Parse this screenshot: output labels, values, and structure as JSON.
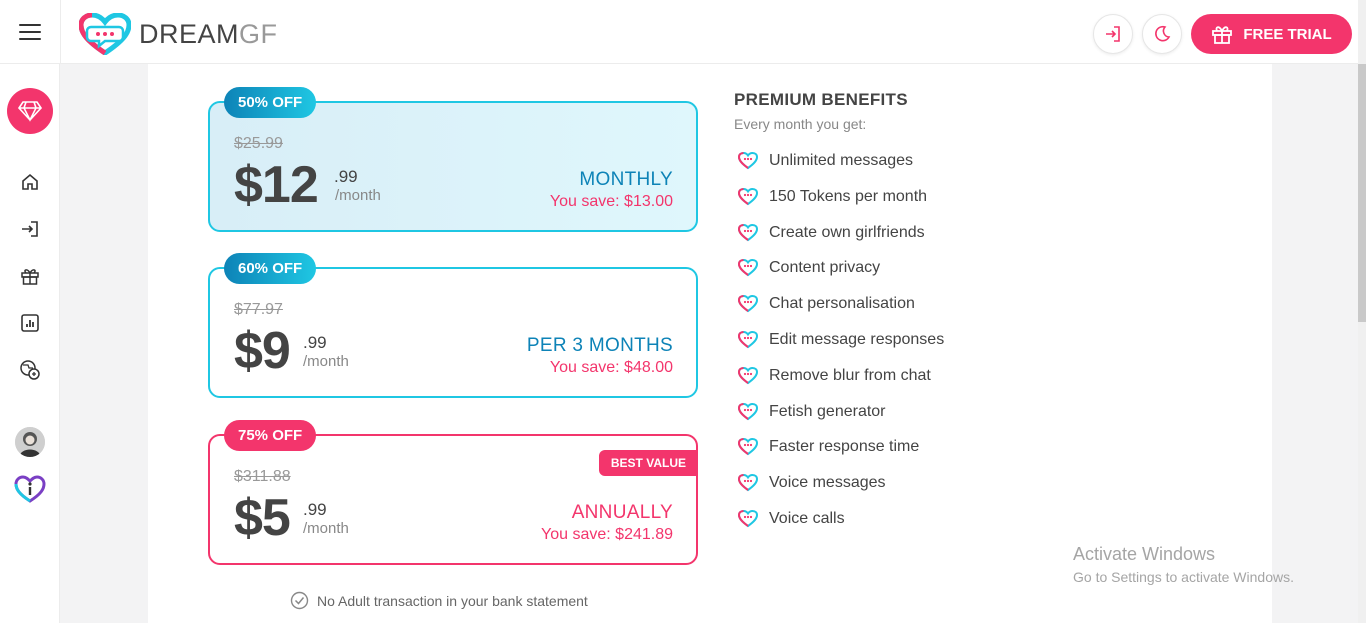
{
  "header": {
    "logo_main": "DREAM",
    "logo_accent": "GF",
    "free_trial_label": "FREE TRIAL"
  },
  "plans": [
    {
      "badge": "50% OFF",
      "old_price": "$25.99",
      "price_main": "$12",
      "price_cents": ".99",
      "per": "/month",
      "name": "MONTHLY",
      "save": "You save: $13.00"
    },
    {
      "badge": "60% OFF",
      "old_price": "$77.97",
      "price_main": "$9",
      "price_cents": ".99",
      "per": "/month",
      "name": "PER 3 MONTHS",
      "save": "You save: $48.00"
    },
    {
      "badge": "75% OFF",
      "old_price": "$311.88",
      "price_main": "$5",
      "price_cents": ".99",
      "per": "/month",
      "name": "ANNUALLY",
      "save": "You save: $241.89",
      "tag": "BEST VALUE"
    }
  ],
  "note": "No Adult transaction in your bank statement",
  "benefits": {
    "title": "PREMIUM BENEFITS",
    "subtitle": "Every month you get:",
    "items": [
      "Unlimited messages",
      "150 Tokens per month",
      "Create own girlfriends",
      "Content privacy",
      "Chat personalisation",
      "Edit message responses",
      "Remove blur from chat",
      "Fetish generator",
      "Faster response time",
      "Voice messages",
      "Voice calls"
    ]
  },
  "watermark": {
    "title": "Activate Windows",
    "subtitle": "Go to Settings to activate Windows."
  },
  "colors": {
    "brand_pink": "#f3356c",
    "brand_cyan": "#1fc7e3",
    "brand_blue": "#0d83b7"
  }
}
